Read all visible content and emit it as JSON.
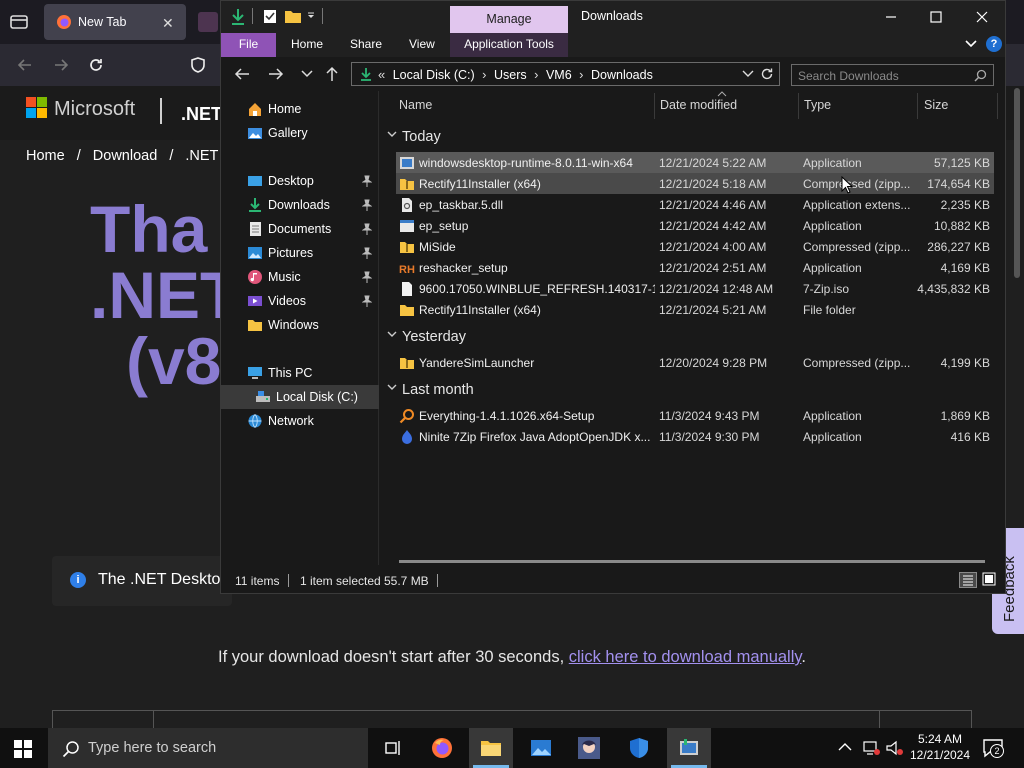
{
  "browser": {
    "tab_title": "New Tab",
    "breadcrumb": [
      "Home",
      "/",
      "Download",
      "/",
      ".NET"
    ],
    "ms_wordmark": "Microsoft",
    "ms_section": ".NET",
    "heading_lines": [
      "Tha",
      ".NET",
      "(v8"
    ],
    "info_text": "The .NET Deskto",
    "download_message": "If your download doesn't start after 30 seconds, ",
    "download_link": "click here to download manually",
    "download_period": ".",
    "feedback_label": "Feedback"
  },
  "explorer": {
    "manage_tab": "Manage",
    "window_title": "Downloads",
    "ribbon": {
      "file": "File",
      "tabs": [
        "Home",
        "Share",
        "View"
      ],
      "app_tools": "Application Tools"
    },
    "address": {
      "overflow": "«",
      "parts": [
        "Local Disk (C:)",
        "Users",
        "VM6",
        "Downloads"
      ]
    },
    "search_placeholder": "Search Downloads",
    "nav": {
      "home": "Home",
      "gallery": "Gallery",
      "desktop": "Desktop",
      "downloads": "Downloads",
      "documents": "Documents",
      "pictures": "Pictures",
      "music": "Music",
      "videos": "Videos",
      "windows": "Windows",
      "this_pc": "This PC",
      "local_disk": "Local Disk (C:)",
      "network": "Network"
    },
    "columns": {
      "name": "Name",
      "date": "Date modified",
      "type": "Type",
      "size": "Size"
    },
    "groups": {
      "today": "Today",
      "yesterday": "Yesterday",
      "last_month": "Last month"
    },
    "files_today": [
      {
        "name": "windowsdesktop-runtime-8.0.11-win-x64",
        "date": "12/21/2024 5:22 AM",
        "type": "Application",
        "size": "57,125 KB",
        "icon": "installer-icon"
      },
      {
        "name": "Rectify11Installer (x64)",
        "date": "12/21/2024 5:18 AM",
        "type": "Compressed (zipp...",
        "size": "174,654 KB",
        "icon": "zip-folder-icon"
      },
      {
        "name": "ep_taskbar.5.dll",
        "date": "12/21/2024 4:46 AM",
        "type": "Application extens...",
        "size": "2,235 KB",
        "icon": "dll-icon"
      },
      {
        "name": "ep_setup",
        "date": "12/21/2024 4:42 AM",
        "type": "Application",
        "size": "10,882 KB",
        "icon": "app-icon"
      },
      {
        "name": "MiSide",
        "date": "12/21/2024 4:00 AM",
        "type": "Compressed (zipp...",
        "size": "286,227 KB",
        "icon": "zip-folder-icon"
      },
      {
        "name": "reshacker_setup",
        "date": "12/21/2024 2:51 AM",
        "type": "Application",
        "size": "4,169 KB",
        "icon": "reshacker-icon"
      },
      {
        "name": "9600.17050.WINBLUE_REFRESH.140317-1...",
        "date": "12/21/2024 12:48 AM",
        "type": "7-Zip.iso",
        "size": "4,435,832 KB",
        "icon": "file-icon"
      },
      {
        "name": "Rectify11Installer (x64)",
        "date": "12/21/2024 5:21 AM",
        "type": "File folder",
        "size": "",
        "icon": "folder-icon"
      }
    ],
    "files_yesterday": [
      {
        "name": "YandereSimLauncher",
        "date": "12/20/2024 9:28 PM",
        "type": "Compressed (zipp...",
        "size": "4,199 KB",
        "icon": "zip-folder-icon"
      }
    ],
    "files_last_month": [
      {
        "name": "Everything-1.4.1.1026.x64-Setup",
        "date": "11/3/2024 9:43 PM",
        "type": "Application",
        "size": "1,869 KB",
        "icon": "search-app-icon"
      },
      {
        "name": "Ninite 7Zip Firefox Java AdoptOpenJDK x...",
        "date": "11/3/2024 9:30 PM",
        "type": "Application",
        "size": "416 KB",
        "icon": "ninite-icon"
      }
    ],
    "status": {
      "items": "11 items",
      "selected": "1 item selected",
      "size": "55.7 MB"
    }
  },
  "taskbar": {
    "search_placeholder": "Type here to search",
    "time": "5:24 AM",
    "date": "12/21/2024",
    "notification_count": "2"
  },
  "colors": {
    "accent_purple": "#8f53b6",
    "manage_tab": "#e1c6ee",
    "heading_purple": "#8a7cd1",
    "link": "#a391ef"
  }
}
